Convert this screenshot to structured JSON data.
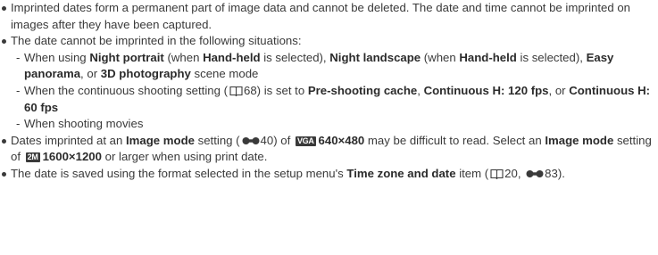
{
  "bullets": [
    {
      "text": "Imprinted dates form a permanent part of image data and cannot be deleted. The date and time cannot be imprinted on images after they have been captured."
    },
    {
      "text": "The date cannot be imprinted in the following situations:",
      "subs": [
        {
          "dash": "-",
          "t1": "When using ",
          "b1": "Night portrait",
          "t2": " (when ",
          "b2": "Hand-held",
          "t3": " is selected), ",
          "b3": "Night landscape",
          "t4": " (when ",
          "b4": "Hand-held",
          "t5": " is selected), ",
          "b5": "Easy panorama",
          "t6": ", or ",
          "b6": "3D photography",
          "t7": " scene mode"
        },
        {
          "dash": "-",
          "t1": "When the continuous shooting setting (",
          "ref": "68",
          "t2": ") is set to ",
          "b1": "Pre-shooting cache",
          "t3": ", ",
          "b2": "Continuous H: 120 fps",
          "t4": ", or ",
          "b3": "Continuous H: 60 fps"
        },
        {
          "dash": "-",
          "t1": "When shooting movies"
        }
      ]
    },
    {
      "t1": "Dates imprinted at an ",
      "b1": "Image mode",
      "t2": " setting (",
      "ref": "40",
      "t3": ") of ",
      "badge1": "VGA",
      "b2": "640×480",
      "t4": " may be difficult to read. Select an ",
      "b3": "Image mode",
      "t5": " setting of ",
      "badge2": "2M",
      "b4": "1600×1200",
      "t6": " or larger when using print date."
    },
    {
      "t1": "The date is saved using the format selected in the setup menu's ",
      "b1": "Time zone and date",
      "t2": " item (",
      "ref1": "20",
      "t3": ", ",
      "ref2": "83",
      "t4": ")."
    }
  ]
}
